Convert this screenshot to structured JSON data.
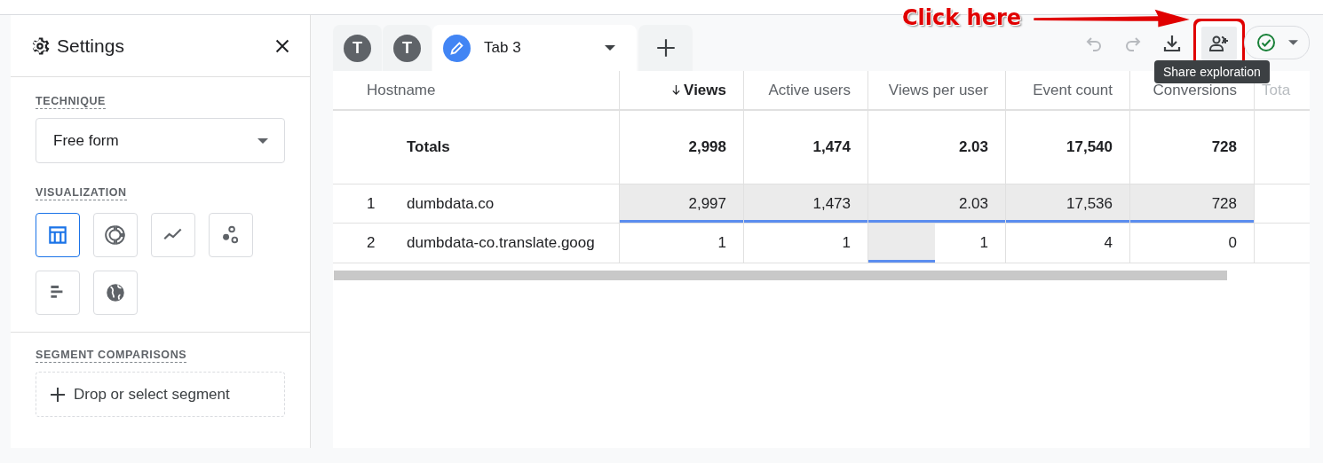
{
  "settings_panel": {
    "title": "Settings",
    "technique": {
      "label": "TECHNIQUE",
      "value": "Free form"
    },
    "visualization": {
      "label": "VISUALIZATION",
      "items": [
        {
          "kind": "table",
          "selected": true
        },
        {
          "kind": "donut",
          "selected": false
        },
        {
          "kind": "line",
          "selected": false
        },
        {
          "kind": "scatter",
          "selected": false
        },
        {
          "kind": "bar",
          "selected": false
        },
        {
          "kind": "geo",
          "selected": false
        }
      ]
    },
    "segment_comparisons": {
      "label": "SEGMENT COMPARISONS",
      "placeholder": "Drop or select segment"
    }
  },
  "tabs": [
    {
      "kind": "avatar",
      "initial": "T",
      "selected": false
    },
    {
      "kind": "avatar",
      "initial": "T",
      "selected": false
    },
    {
      "kind": "edit",
      "label": "Tab 3",
      "selected": true
    }
  ],
  "toolbar": [
    {
      "kind": "undo",
      "disabled": true
    },
    {
      "kind": "redo",
      "disabled": true
    },
    {
      "kind": "download",
      "disabled": false
    },
    {
      "kind": "share",
      "disabled": false,
      "highlighted": true
    }
  ],
  "tooltip": "Share exploration",
  "callout": {
    "text": "Click here"
  },
  "table": {
    "columns": [
      {
        "label": "Hostname",
        "sorted": false
      },
      {
        "label": "Views",
        "sorted": true
      },
      {
        "label": "Active users",
        "sorted": false
      },
      {
        "label": "Views per user",
        "sorted": false
      },
      {
        "label": "Event count",
        "sorted": false
      },
      {
        "label": "Conversions",
        "sorted": false
      },
      {
        "label": "Tota",
        "sorted": false
      }
    ],
    "totals": [
      "Totals",
      "2,998",
      "1,474",
      "2.03",
      "17,540",
      "728"
    ],
    "rows": [
      {
        "index": "1",
        "cells": [
          {
            "value": "dumbdata.co"
          },
          {
            "value": "2,997",
            "level": 1
          },
          {
            "value": "1,473",
            "level": 1
          },
          {
            "value": "2.03",
            "level": 1
          },
          {
            "value": "17,536",
            "level": 1
          },
          {
            "value": "728",
            "level": 1
          }
        ]
      },
      {
        "index": "2",
        "cells": [
          {
            "value": "dumbdata-co.translate.goog"
          },
          {
            "value": "1"
          },
          {
            "value": "1"
          },
          {
            "value": "1",
            "level": 0.49
          },
          {
            "value": "4"
          },
          {
            "value": "0"
          }
        ]
      }
    ]
  }
}
